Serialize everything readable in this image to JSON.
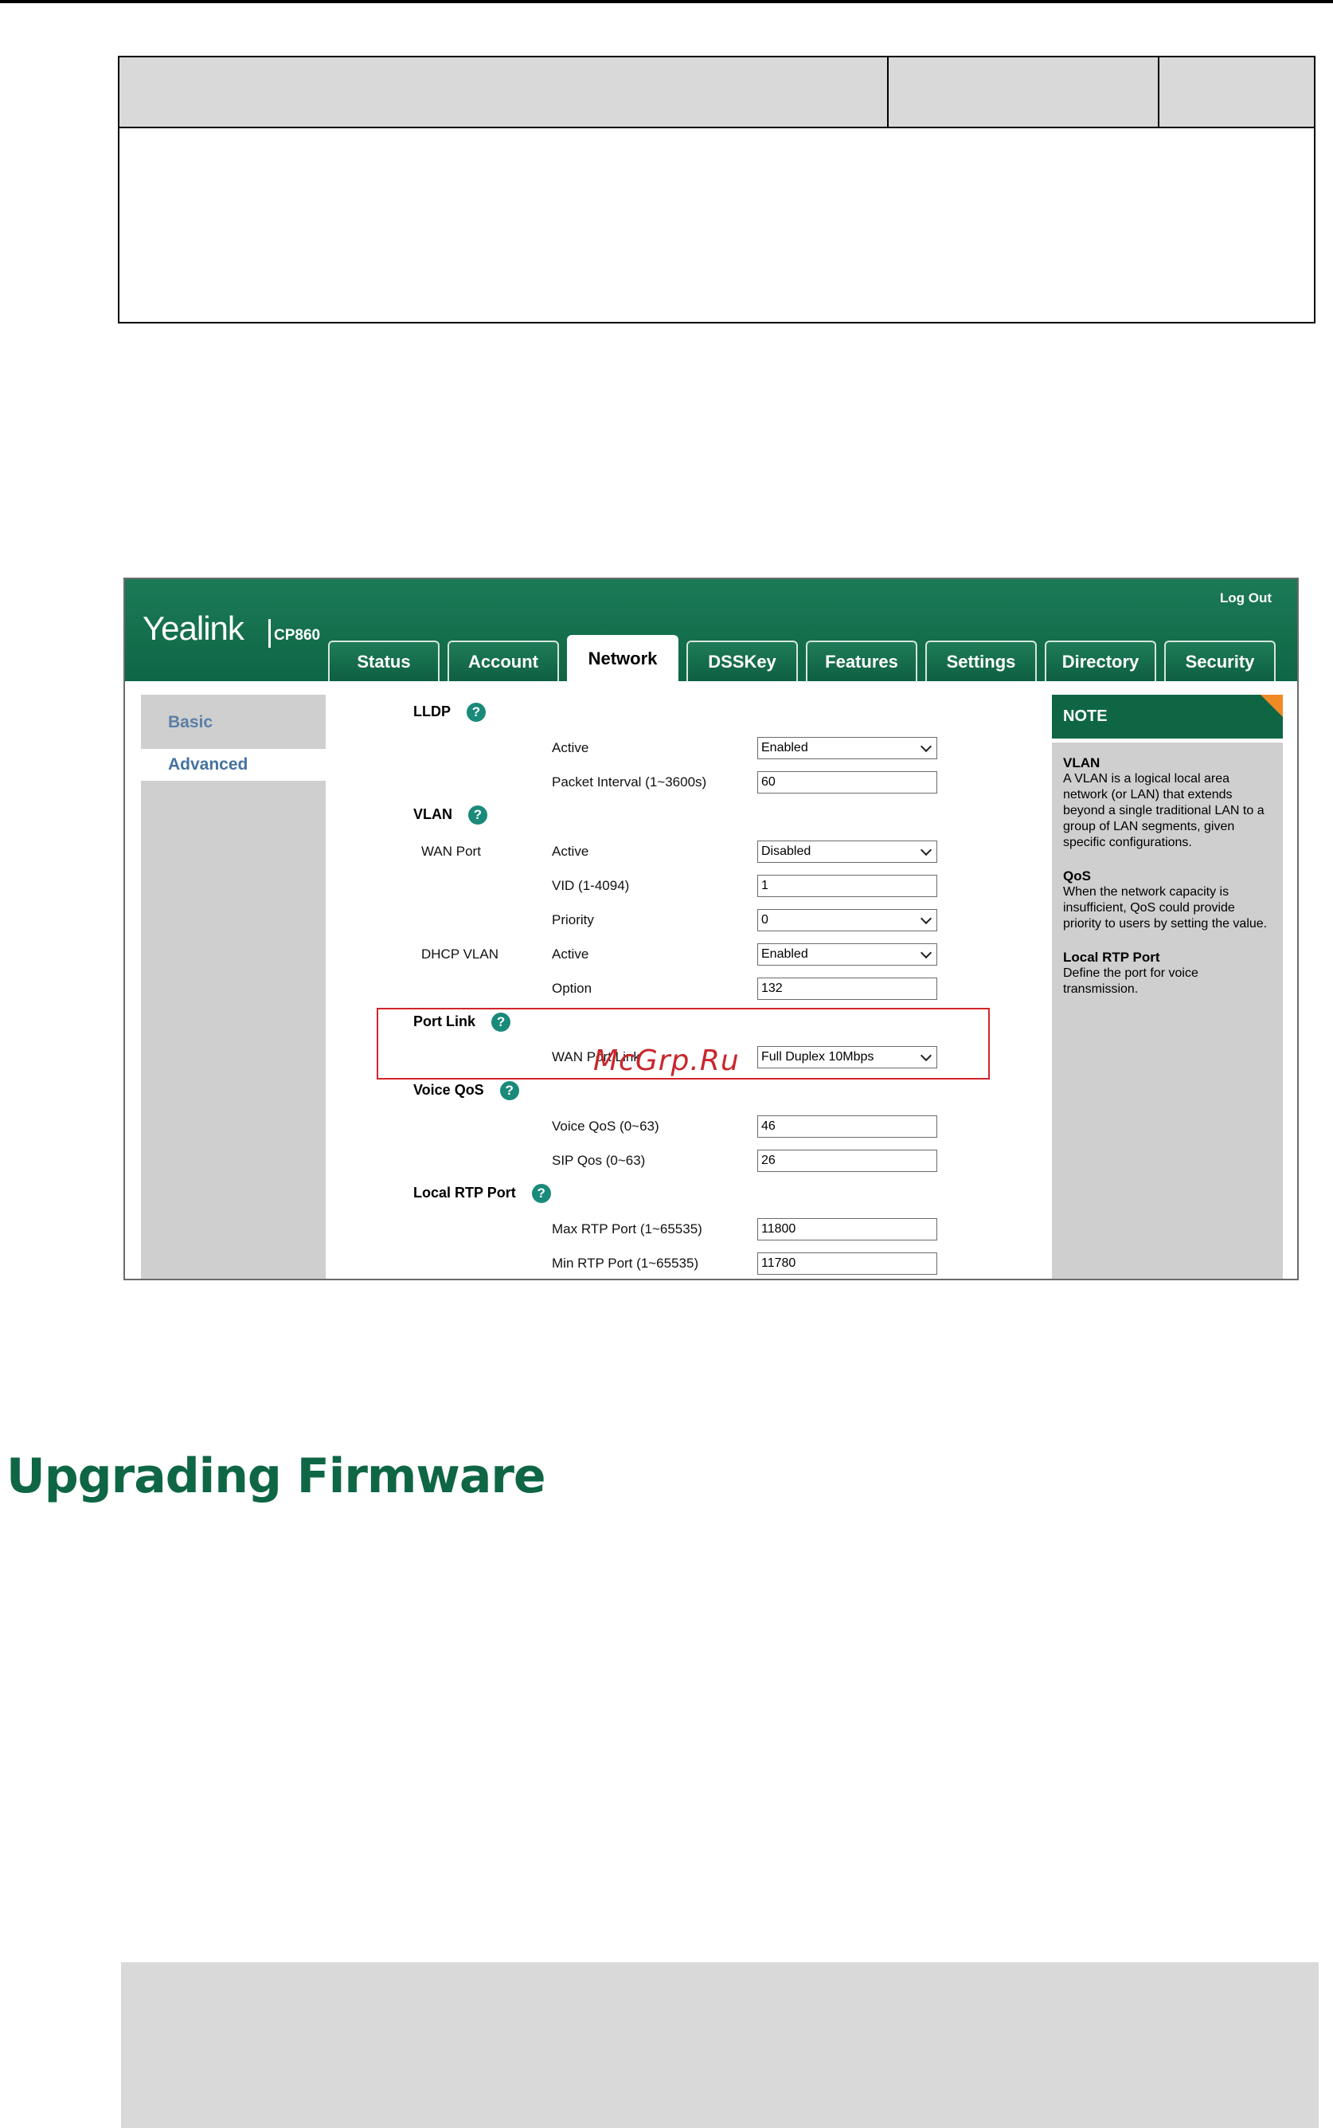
{
  "app": {
    "logo": "Yealink",
    "model": "CP860",
    "logout": "Log Out"
  },
  "tabs": [
    {
      "label": "Status",
      "active": false
    },
    {
      "label": "Account",
      "active": false
    },
    {
      "label": "Network",
      "active": true
    },
    {
      "label": "DSSKey",
      "active": false
    },
    {
      "label": "Features",
      "active": false
    },
    {
      "label": "Settings",
      "active": false
    },
    {
      "label": "Directory",
      "active": false
    },
    {
      "label": "Security",
      "active": false
    }
  ],
  "sidebar": {
    "items": [
      {
        "label": "Basic",
        "selected": false
      },
      {
        "label": "Advanced",
        "selected": true
      }
    ]
  },
  "form": {
    "lldp": {
      "title": "LLDP",
      "active_label": "Active",
      "active_value": "Enabled",
      "interval_label": "Packet Interval (1~3600s)",
      "interval_value": "60"
    },
    "vlan": {
      "title": "VLAN",
      "wan_port_label": "WAN Port",
      "wan_active_label": "Active",
      "wan_active_value": "Disabled",
      "vid_label": "VID (1-4094)",
      "vid_value": "1",
      "priority_label": "Priority",
      "priority_value": "0",
      "dhcp_label": "DHCP VLAN",
      "dhcp_active_label": "Active",
      "dhcp_active_value": "Enabled",
      "option_label": "Option",
      "option_value": "132"
    },
    "port_link": {
      "title": "Port Link",
      "wan_port_link_label": "WAN Port Link",
      "wan_port_link_value": "Full Duplex 10Mbps"
    },
    "voice_qos": {
      "title": "Voice QoS",
      "voice_label": "Voice QoS (0~63)",
      "voice_value": "46",
      "sip_label": "SIP Qos (0~63)",
      "sip_value": "26"
    },
    "rtp": {
      "title": "Local RTP Port",
      "max_label": "Max RTP Port (1~65535)",
      "max_value": "11800",
      "min_label": "Min RTP Port (1~65535)",
      "min_value": "11780"
    }
  },
  "note": {
    "header": "NOTE",
    "sections": [
      {
        "title": "VLAN",
        "text": "A VLAN is a logical local area network (or LAN) that extends beyond a single traditional LAN to a group of LAN segments, given specific configurations."
      },
      {
        "title": "QoS",
        "text": "When the network capacity is insufficient, QoS could provide priority to users by setting the value."
      },
      {
        "title": "Local RTP Port",
        "text": "Define the port for voice transmission."
      }
    ]
  },
  "watermark": "McGrp.Ru",
  "heading": "Upgrading Firmware",
  "colors": {
    "brand_green": "#0e6645",
    "highlight_red": "#d3242a",
    "note_accent": "#f08a24"
  }
}
